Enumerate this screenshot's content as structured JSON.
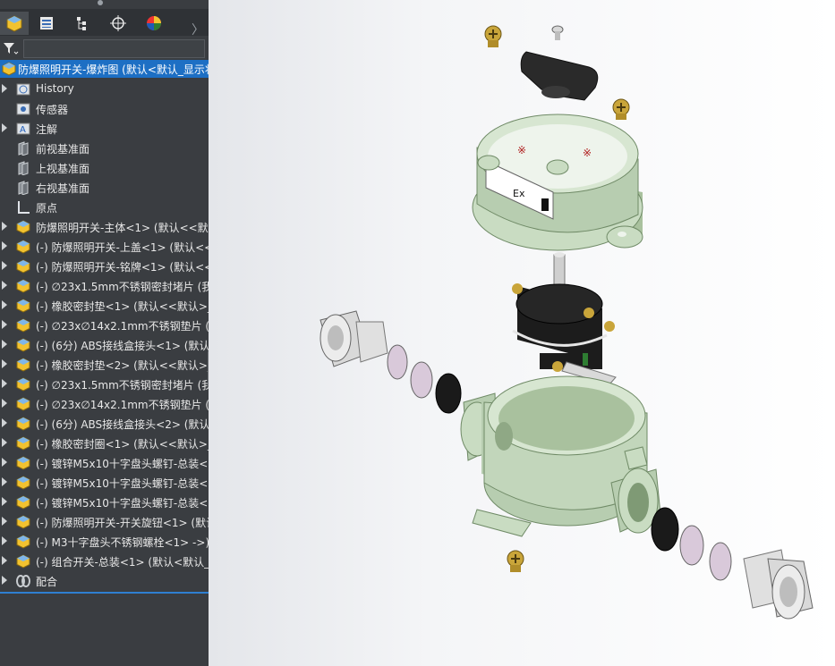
{
  "feature_tree": {
    "root": "防爆照明开关-爆炸图 (默认<默认_显示状",
    "items": [
      {
        "label": "History",
        "icon": "history-icon",
        "expand": true
      },
      {
        "label": "传感器",
        "icon": "sensor-icon",
        "expand": false
      },
      {
        "label": "注解",
        "icon": "annotation-icon",
        "expand": true
      },
      {
        "label": "前视基准面",
        "icon": "plane-icon",
        "expand": false
      },
      {
        "label": "上视基准面",
        "icon": "plane-icon",
        "expand": false
      },
      {
        "label": "右视基准面",
        "icon": "plane-icon",
        "expand": false
      },
      {
        "label": "原点",
        "icon": "origin-icon",
        "expand": false
      },
      {
        "label": "防爆照明开关-主体<1> (默认<<默认",
        "icon": "part-icon",
        "expand": true
      },
      {
        "label": "(-) 防爆照明开关-上盖<1> (默认<<",
        "icon": "part-icon",
        "expand": true
      },
      {
        "label": "(-) 防爆照明开关-铭牌<1> (默认<<",
        "icon": "part-icon",
        "expand": true
      },
      {
        "label": "(-) ∅23x1.5mm不锈钢密封堵片 (我",
        "icon": "part-icon",
        "expand": true
      },
      {
        "label": "(-) 橡胶密封垫<1> (默认<<默认>_",
        "icon": "part-icon",
        "expand": true
      },
      {
        "label": "(-) ∅23x∅14x2.1mm不锈钢垫片 (",
        "icon": "part-icon",
        "expand": true
      },
      {
        "label": "(-) (6分) ABS接线盒接头<1> (默认",
        "icon": "part-icon",
        "expand": true
      },
      {
        "label": "(-) 橡胶密封垫<2> (默认<<默认>_",
        "icon": "part-icon",
        "expand": true
      },
      {
        "label": "(-) ∅23x1.5mm不锈钢密封堵片 (我",
        "icon": "part-icon",
        "expand": true
      },
      {
        "label": "(-) ∅23x∅14x2.1mm不锈钢垫片 (",
        "icon": "part-icon",
        "expand": true
      },
      {
        "label": "(-) (6分) ABS接线盒接头<2> (默认",
        "icon": "part-icon",
        "expand": true
      },
      {
        "label": "(-) 橡胶密封圈<1> (默认<<默认>_",
        "icon": "part-icon",
        "expand": true
      },
      {
        "label": "(-) 镀锌M5x10十字盘头螺钉-总装<",
        "icon": "part-icon",
        "expand": true
      },
      {
        "label": "(-) 镀锌M5x10十字盘头螺钉-总装<",
        "icon": "part-icon",
        "expand": true
      },
      {
        "label": "(-) 镀锌M5x10十字盘头螺钉-总装<",
        "icon": "part-icon",
        "expand": true
      },
      {
        "label": "(-) 防爆照明开关-开关旋钮<1> (默认",
        "icon": "part-icon",
        "expand": true
      },
      {
        "label": "(-) M3十字盘头不锈钢螺栓<1> ->)",
        "icon": "part-icon",
        "expand": true
      },
      {
        "label": "(-) 组合开关-总装<1> (默认<默认_",
        "icon": "part-icon",
        "expand": true
      },
      {
        "label": "配合",
        "icon": "mates-icon",
        "expand": true
      }
    ]
  },
  "tabs": [
    "feature-manager-tab",
    "property-manager-tab",
    "configuration-manager-tab",
    "dimxpert-tab",
    "display-manager-tab"
  ],
  "nameplate": {
    "mark": "Ex"
  },
  "colors": {
    "panel": "#3a3d41",
    "selection": "#1d6fc4",
    "part_green": "#c9dcc2"
  }
}
